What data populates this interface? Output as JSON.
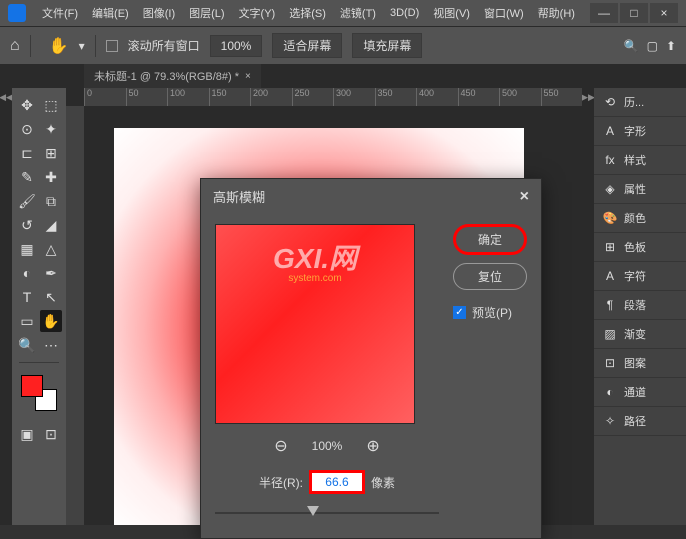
{
  "menu": {
    "items": [
      "文件(F)",
      "编辑(E)",
      "图像(I)",
      "图层(L)",
      "文字(Y)",
      "选择(S)",
      "滤镜(T)",
      "3D(D)",
      "视图(V)",
      "窗口(W)",
      "帮助(H)"
    ]
  },
  "options": {
    "scroll_all": "滚动所有窗口",
    "zoom": "100%",
    "fit_screen": "适合屏幕",
    "fill_screen": "填充屏幕"
  },
  "document": {
    "tab": "未标题-1 @ 79.3%(RGB/8#) *"
  },
  "ruler": {
    "marks": [
      "0",
      "50",
      "100",
      "150",
      "200",
      "250",
      "300",
      "350",
      "400",
      "450",
      "500",
      "550"
    ]
  },
  "panels": {
    "items": [
      {
        "icon": "⟲",
        "label": "历..."
      },
      {
        "icon": "A",
        "label": "字形"
      },
      {
        "icon": "fx",
        "label": "样式"
      },
      {
        "icon": "◈",
        "label": "属性"
      },
      {
        "icon": "🎨",
        "label": "颜色"
      },
      {
        "icon": "⊞",
        "label": "色板"
      },
      {
        "icon": "A",
        "label": "字符"
      },
      {
        "icon": "¶",
        "label": "段落"
      },
      {
        "icon": "▨",
        "label": "渐变"
      },
      {
        "icon": "⊡",
        "label": "图案"
      },
      {
        "icon": "◐",
        "label": "通道"
      },
      {
        "icon": "✧",
        "label": "路径"
      }
    ]
  },
  "dialog": {
    "title": "高斯模糊",
    "ok": "确定",
    "reset": "复位",
    "preview": "预览(P)",
    "zoom": "100%",
    "radius_label": "半径(R):",
    "radius_value": "66.6",
    "radius_unit": "像素",
    "watermark": {
      "line1": "GXI.网",
      "line2": "system.com"
    }
  }
}
